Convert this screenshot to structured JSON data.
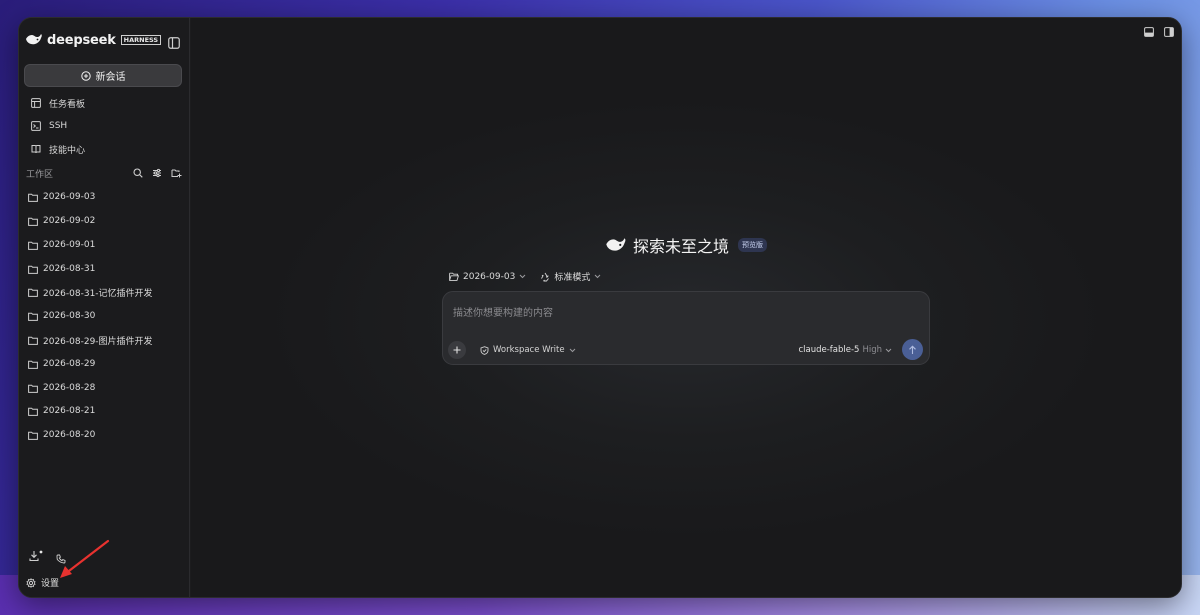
{
  "app": {
    "brand_name": "deepseek",
    "brand_badge": "HARNESS"
  },
  "sidebar": {
    "new_chat_label": "新会话",
    "nav_items": [
      {
        "label": "任务看板",
        "icon": "board-icon"
      },
      {
        "label": "SSH",
        "icon": "terminal-icon"
      },
      {
        "label": "技能中心",
        "icon": "book-icon"
      }
    ],
    "workspace": {
      "title": "工作区",
      "folders": [
        "2026-09-03",
        "2026-09-02",
        "2026-09-01",
        "2026-08-31",
        "2026-08-31-记忆插件开发",
        "2026-08-30",
        "2026-08-29-图片插件开发",
        "2026-08-29",
        "2026-08-28",
        "2026-08-21",
        "2026-08-20"
      ]
    },
    "settings_label": "设置"
  },
  "main": {
    "hero_title": "探索未至之境",
    "hero_badge": "预览版",
    "context": {
      "folder": "2026-09-03",
      "mode": "标准模式"
    },
    "composer": {
      "placeholder": "描述你想要构建的内容",
      "permission_mode": "Workspace Write",
      "model": "claude-fable-5",
      "effort": "High"
    }
  },
  "colors": {
    "window_bg": "#1c1c1e",
    "sidebar_bg": "#1b1b1d",
    "accent_send": "#4a5f96",
    "annotation_arrow": "#e8322f"
  }
}
